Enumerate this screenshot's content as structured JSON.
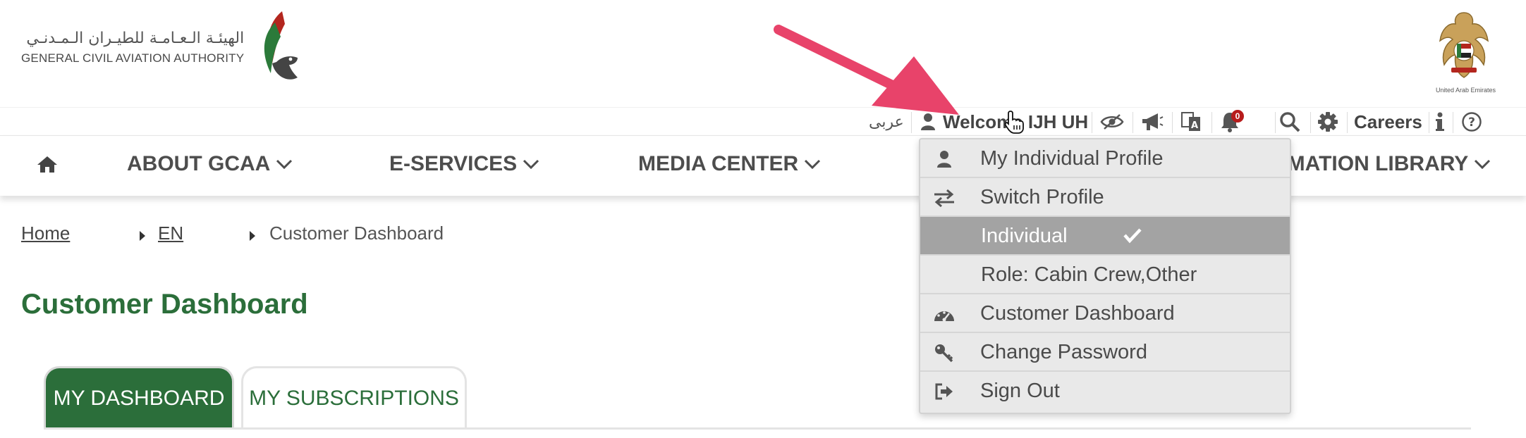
{
  "header": {
    "logo_arabic": "الهيئـة الـعـامـة للطيـران الـمـدنـي",
    "logo_english": "GENERAL CIVIL AVIATION AUTHORITY",
    "emblem_caption": "United Arab Emirates"
  },
  "utilbar": {
    "arabic_link": "عربى",
    "welcome": "Welcome IJH UH",
    "notification_count": "0",
    "careers": "Careers",
    "icons": [
      "user-icon",
      "eye-off-icon",
      "megaphone-icon",
      "translate-icon",
      "bell-icon",
      "search-icon",
      "gear-icon",
      "info-icon",
      "help-icon"
    ]
  },
  "mainnav": {
    "items": [
      {
        "label": "ABOUT GCAA"
      },
      {
        "label": "E-SERVICES"
      },
      {
        "label": "MEDIA CENTER"
      },
      {
        "label": "RMATION LIBRARY"
      }
    ]
  },
  "breadcrumb": {
    "home": "Home",
    "lang": "EN",
    "current": "Customer Dashboard"
  },
  "page": {
    "title": "Customer Dashboard"
  },
  "tabs": [
    {
      "label": "MY DASHBOARD",
      "active": true
    },
    {
      "label": "MY SUBSCRIPTIONS",
      "active": false
    }
  ],
  "dropdown": {
    "items": [
      {
        "label": "My Individual Profile",
        "icon": "user-icon"
      },
      {
        "label": "Switch Profile",
        "icon": "switch-arrows-icon"
      },
      {
        "label": "Individual",
        "icon": "",
        "selected": true
      },
      {
        "label": "Role: Cabin Crew,Other",
        "icon": ""
      },
      {
        "label": "Customer Dashboard",
        "icon": "dashboard-gauge-icon"
      },
      {
        "label": "Change Password",
        "icon": "key-icon"
      },
      {
        "label": "Sign Out",
        "icon": "sign-out-icon"
      }
    ]
  },
  "colors": {
    "brand_green": "#2b6e3a",
    "annotation_arrow": "#e8436a",
    "badge_red": "#b71c1c",
    "selected_row": "#a3a3a3"
  }
}
